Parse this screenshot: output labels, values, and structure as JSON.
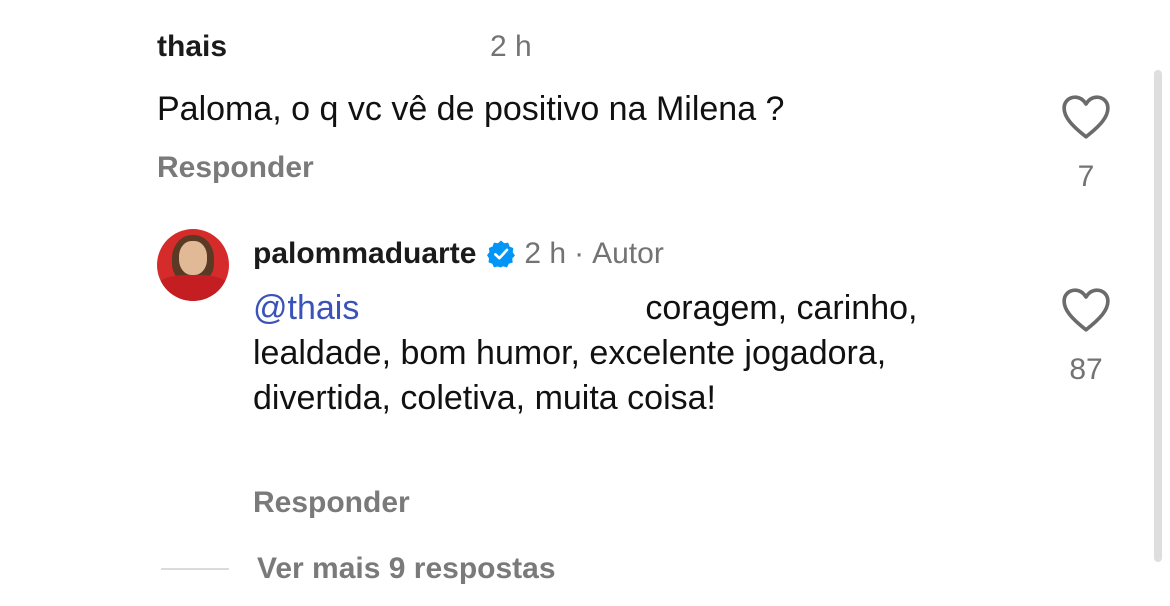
{
  "comment": {
    "username": "thais",
    "time": "2 h",
    "text": "Paloma, o q vc vê de positivo na Milena ?",
    "reply_label": "Responder",
    "likes": "7"
  },
  "reply": {
    "username": "palommaduarte",
    "time": "2 h",
    "separator": "·",
    "author_badge": "Autor",
    "mention": "@thais",
    "text_line1": "coragem, carinho,",
    "text_rest": "lealdade, bom humor, excelente jogadora, divertida, coletiva, muita coisa!",
    "reply_label": "Responder",
    "likes": "87"
  },
  "view_more": {
    "label": "Ver mais 9 respostas"
  },
  "colors": {
    "mention": "#3a53b8",
    "verified": "#0095f6",
    "muted": "#737373"
  },
  "icons": {
    "like": "heart-outline",
    "verified": "verified-badge"
  }
}
